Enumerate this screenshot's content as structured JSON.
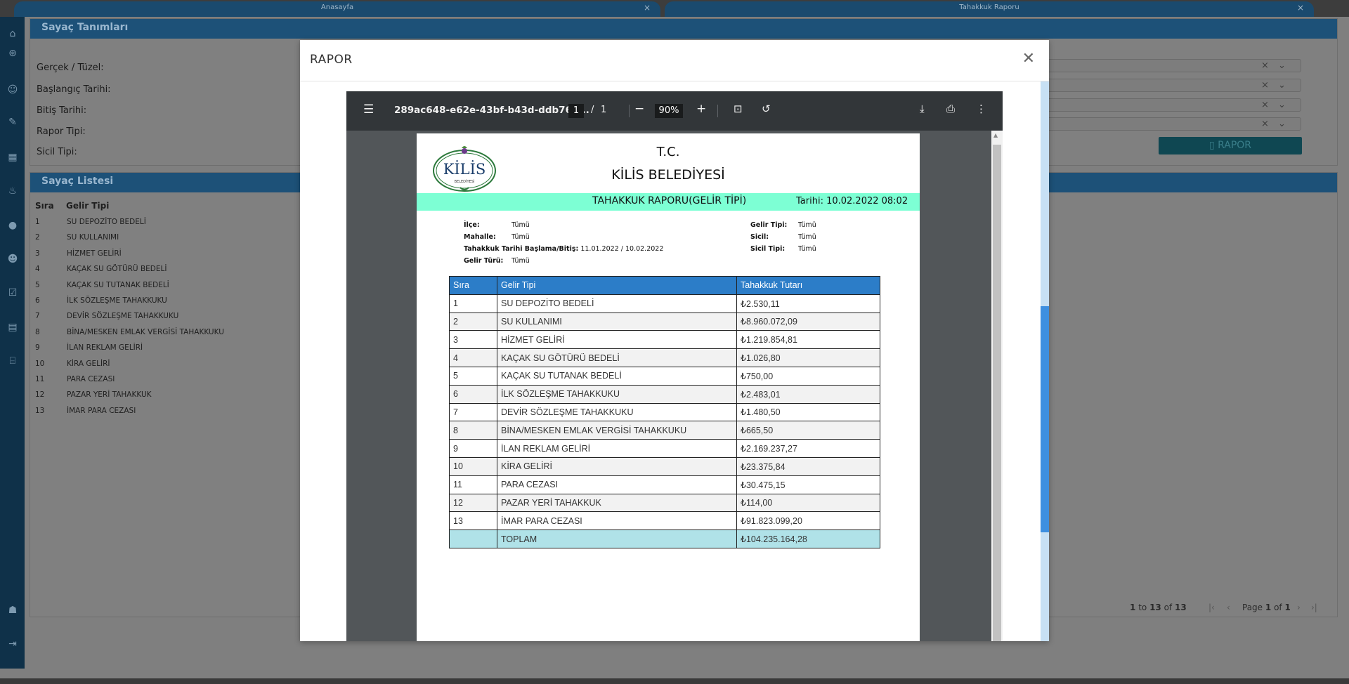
{
  "tabs": [
    {
      "label": "Anasayfa"
    },
    {
      "label": "Tahakkuk Raporu"
    }
  ],
  "filter_panel": {
    "title": "Sayaç Tanımları",
    "labels": [
      "Gerçek / Tüzel:",
      "Başlangıç Tarihi:",
      "Bitiş Tarihi:",
      "Rapor Tipi:",
      "Sicil Tipi:"
    ],
    "report_button": "RAPOR"
  },
  "list_panel": {
    "title": "Sayaç Listesi",
    "headers": {
      "sira": "Sıra",
      "gelir_tipi": "Gelir Tipi"
    },
    "rows": [
      {
        "no": "1",
        "name": "SU DEPOZİTO BEDELİ"
      },
      {
        "no": "2",
        "name": "SU KULLANIMI"
      },
      {
        "no": "3",
        "name": "HİZMET GELİRİ"
      },
      {
        "no": "4",
        "name": "KAÇAK SU GÖTÜRÜ BEDELİ"
      },
      {
        "no": "5",
        "name": "KAÇAK SU TUTANAK BEDELİ"
      },
      {
        "no": "6",
        "name": "İLK SÖZLEŞME TAHAKKUKU"
      },
      {
        "no": "7",
        "name": "DEVİR SÖZLEŞME TAHAKKUKU"
      },
      {
        "no": "8",
        "name": "BİNA/MESKEN EMLAK VERGİSİ TAHAKKUKU"
      },
      {
        "no": "9",
        "name": "İLAN REKLAM GELİRİ"
      },
      {
        "no": "10",
        "name": "KİRA GELİRİ"
      },
      {
        "no": "11",
        "name": "PARA CEZASI"
      },
      {
        "no": "12",
        "name": "PAZAR YERİ TAHAKKUK"
      },
      {
        "no": "13",
        "name": "İMAR PARA CEZASI"
      }
    ],
    "pager": {
      "range_from": "1",
      "range_to": "13",
      "total": "13",
      "page": "1",
      "pages": "1",
      "to_word": "to",
      "of_word": "of",
      "page_word": "Page"
    }
  },
  "modal": {
    "title": "RAPOR",
    "viewer": {
      "filename": "289ac648-e62e-43bf-b43d-ddb769...",
      "page_current": "1",
      "page_separator": "/",
      "page_total": "1",
      "zoom": "90%"
    },
    "report": {
      "logo_text": "KİLİS",
      "logo_sub": "BELEDİYESİ",
      "header_tc": "T.C.",
      "header_municipality": "KİLİS BELEDİYESİ",
      "title": "TAHAKKUK RAPORU(GELİR TİPİ)",
      "date_text": "Tarihi: 10.02.2022 08:02",
      "meta_left": [
        {
          "label": "İlçe:",
          "value": "Tümü"
        },
        {
          "label": "Mahalle:",
          "value": "Tümü"
        },
        {
          "label": "Tahakkuk Tarihi Başlama/Bitiş:",
          "value": "11.01.2022 / 10.02.2022"
        },
        {
          "label": "Gelir Türü:",
          "value": "Tümü"
        }
      ],
      "meta_right": [
        {
          "label": "Gelir Tipi:",
          "value": "Tümü"
        },
        {
          "label": "Sicil:",
          "value": "Tümü"
        },
        {
          "label": "Sicil Tipi:",
          "value": "Tümü"
        }
      ],
      "table_headers": [
        "Sıra",
        "Gelir Tipi",
        "Tahakkuk Tutarı"
      ],
      "rows": [
        {
          "no": "1",
          "name": "SU DEPOZİTO BEDELİ",
          "amount": "₺2.530,11"
        },
        {
          "no": "2",
          "name": "SU KULLANIMI",
          "amount": "₺8.960.072,09"
        },
        {
          "no": "3",
          "name": "HİZMET GELİRİ",
          "amount": "₺1.219.854,81"
        },
        {
          "no": "4",
          "name": "KAÇAK SU GÖTÜRÜ BEDELİ",
          "amount": "₺1.026,80"
        },
        {
          "no": "5",
          "name": "KAÇAK SU TUTANAK BEDELİ",
          "amount": "₺750,00"
        },
        {
          "no": "6",
          "name": "İLK SÖZLEŞME TAHAKKUKU",
          "amount": "₺2.483,01"
        },
        {
          "no": "7",
          "name": "DEVİR SÖZLEŞME TAHAKKUKU",
          "amount": "₺1.480,50"
        },
        {
          "no": "8",
          "name": "BİNA/MESKEN EMLAK VERGİSİ TAHAKKUKU",
          "amount": "₺665,50"
        },
        {
          "no": "9",
          "name": "İLAN REKLAM GELİRİ",
          "amount": "₺2.169.237,27"
        },
        {
          "no": "10",
          "name": "KİRA GELİRİ",
          "amount": "₺23.375,84"
        },
        {
          "no": "11",
          "name": "PARA CEZASI",
          "amount": "₺30.475,15"
        },
        {
          "no": "12",
          "name": "PAZAR YERİ TAHAKKUK",
          "amount": "₺114,00"
        },
        {
          "no": "13",
          "name": "İMAR PARA CEZASI",
          "amount": "₺91.823.099,20"
        }
      ],
      "total": {
        "label": "TOPLAM",
        "amount": "₺104.235.164,28"
      }
    }
  },
  "colors": {
    "header_blue": "#2c7dc8",
    "title_band": "#7dffd4",
    "total_row": "#b0e2e8",
    "sidebar": "#0f3149"
  },
  "icons": [
    "home-icon",
    "login-icon",
    "user-icon",
    "edit-icon",
    "dashboard-icon",
    "hand-water-icon",
    "water-drop-icon",
    "users-icon",
    "checklist-icon",
    "report-icon",
    "bank-icon",
    "admin-icon",
    "logout-icon"
  ]
}
